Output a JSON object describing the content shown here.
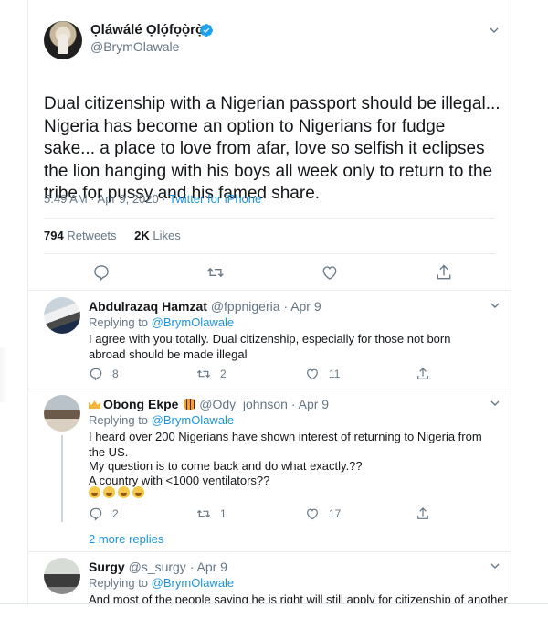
{
  "main_tweet": {
    "author_name": "Ọláwálé Ọlọ́fọọ̀rọ̀",
    "handle": "@BrymOlawale",
    "text": "Dual citizenship with a Nigerian passport should be illegal... Nigeria has become an option to Nigerians for fudge sake... a place to love from afar, love so selfish it eclipses the lion hanging with his boys all week only to return to the tribe for pussy and his famed share.",
    "time": "5:49 AM · Apr 9, 2020",
    "source": "Twitter for iPhone",
    "retweets_count": "794",
    "retweets_label": "Retweets",
    "likes_count": "2K",
    "likes_label": "Likes",
    "verified": true
  },
  "replies": [
    {
      "name": "Abdulrazaq Hamzat",
      "handle": "@fppnigeria",
      "date": "Apr 9",
      "replying_prefix": "Replying to",
      "replying_to": "@BrymOlawale",
      "text": "I agree with you totally. Dual citizenship, especially for those not born abroad should be made illegal",
      "reply_count": "8",
      "retweet_count": "2",
      "like_count": "11"
    },
    {
      "name": "Obong Ekpe",
      "handle": "@Ody_johnson",
      "date": "Apr 9",
      "replying_prefix": "Replying to",
      "replying_to": "@BrymOlawale",
      "text_line1": "I heard over 200 Nigerians have shown interest of returning to Nigeria from the US.",
      "text_line2": "My question is to come back and do what exactly.??",
      "text_line3": "A country with <1000 ventilators??",
      "reply_count": "2",
      "retweet_count": "1",
      "like_count": "17"
    },
    {
      "name": "Surgy",
      "handle": "@s_surgy",
      "date": "Apr 9",
      "replying_prefix": "Replying to",
      "replying_to": "@BrymOlawale",
      "text": "And most of the people saying he is right will still apply for citizenship of another"
    }
  ],
  "more_replies": "2 more replies",
  "colors": {
    "link": "#1b95e0",
    "muted": "#657786",
    "text": "#14171a",
    "border": "#e6ecf0"
  },
  "icons": [
    "chevron-down-icon",
    "verified-badge-icon",
    "reply-icon",
    "retweet-icon",
    "like-icon",
    "share-icon",
    "emoji-crown-icon",
    "emoji-tiger-icon",
    "emoji-sweat-smile-icon"
  ]
}
